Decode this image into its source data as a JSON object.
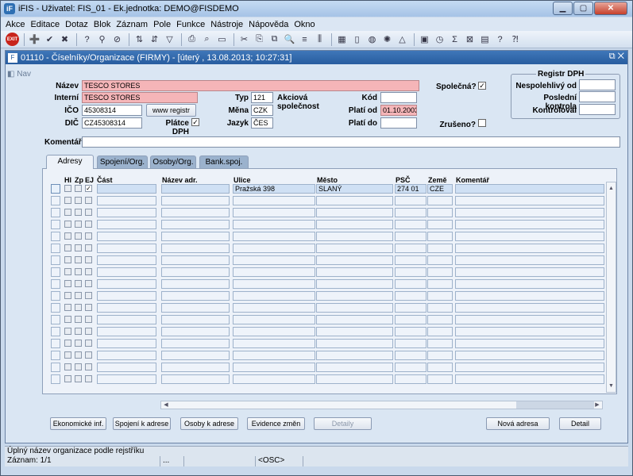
{
  "window": {
    "title": "iFIS - Uživatel: FIS_01 - Ek.jednotka: DEMO@FISDEMO",
    "app_icon_text": "iF"
  },
  "menu": [
    "Akce",
    "Editace",
    "Dotaz",
    "Blok",
    "Záznam",
    "Pole",
    "Funkce",
    "Nástroje",
    "Nápověda",
    "Okno"
  ],
  "toolbar": {
    "exit_label": "EXIT"
  },
  "form": {
    "title": "01110 - Číselníky/Organizace (FIRMY) - [úterý  , 13.08.2013; 10:27:31]",
    "nav_label": "Nav",
    "labels": {
      "nazev": "Název",
      "interni": "Interní",
      "ico": "IČO",
      "dic": "DIČ",
      "typ": "Typ",
      "mena": "Měna",
      "jazyk": "Jazyk",
      "kod": "Kód",
      "plati_od": "Platí od",
      "plati_do": "Platí do",
      "spolecna": "Společná?",
      "zruseno": "Zrušeno?",
      "platce_dph": "Plátce DPH",
      "komentar": "Komentář"
    },
    "values": {
      "nazev": "TESCO STORES",
      "interni": "TESCO STORES",
      "ico": "45308314",
      "dic": "CZ45308314",
      "typ": "121",
      "typ_name": "Akciová společnost",
      "mena": "CZK",
      "jazyk": "ČES",
      "kod": "",
      "plati_od": "01.10.2003",
      "plati_do": "",
      "komentar": ""
    },
    "www_button": "www registr",
    "registr": {
      "title": "Registr DPH",
      "labels": [
        "Nespolehlivý od",
        "Poslední kontrola",
        "Kontroloval"
      ]
    }
  },
  "tabs": [
    "Adresy",
    "Spojení/Org.",
    "Osoby/Org.",
    "Bank.spoj."
  ],
  "grid": {
    "columns": {
      "hl": "Hl",
      "zp": "Zp",
      "ej": "EJ",
      "cast": "Část",
      "nazev_adr": "Název adr.",
      "ulice": "Ulice",
      "mesto": "Město",
      "psc": "PSČ",
      "zeme": "Země",
      "komentar": "Komentář"
    },
    "rows": [
      {
        "hl": false,
        "zp": false,
        "ej": true,
        "cast": "",
        "nazev_adr": "",
        "ulice": "Pražská 398",
        "mesto": "SLANÝ",
        "psc": "274 01",
        "zeme": "CZE",
        "komentar": ""
      }
    ],
    "total_rows": 17
  },
  "buttons": {
    "ekonomicke": "Ekonomické inf.",
    "spojeni": "Spojení k adrese",
    "osoby": "Osoby k adrese",
    "evidence": "Evidence změn",
    "detaily": "Detaily",
    "nova_adresa": "Nová adresa",
    "detail": "Detail"
  },
  "status": {
    "hint": "Úplný název organizace podle rejstříku",
    "record": "Záznam: 1/1",
    "seg2": "...",
    "osc": "<OSC>"
  }
}
